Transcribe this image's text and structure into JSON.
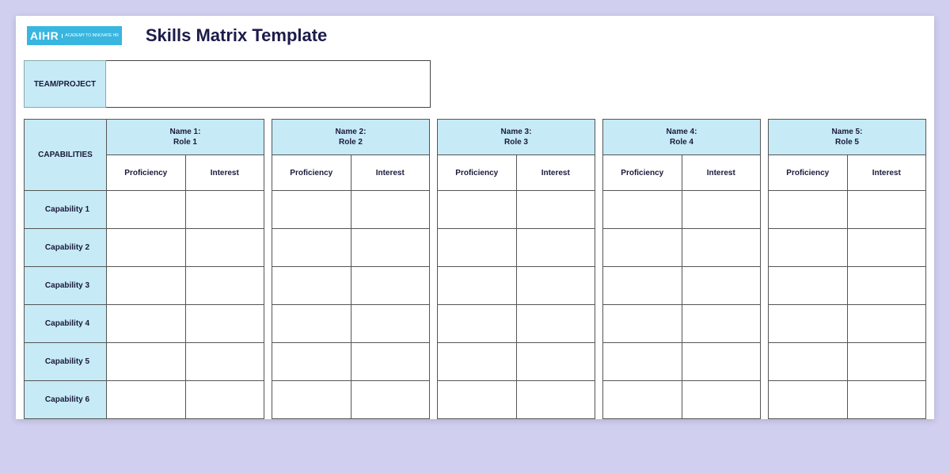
{
  "logo": {
    "main": "AIHR",
    "sub": "ACADEMY TO\nINNOVATE HR"
  },
  "title": "Skills Matrix Template",
  "team_project_label": "TEAM/PROJECT",
  "team_project_value": "",
  "capabilities_header": "CAPABILITIES",
  "people": [
    {
      "name": "Name 1:",
      "role": "Role 1"
    },
    {
      "name": "Name 2:",
      "role": "Role 2"
    },
    {
      "name": "Name 3:",
      "role": "Role 3"
    },
    {
      "name": "Name 4:",
      "role": "Role 4"
    },
    {
      "name": "Name 5:",
      "role": "Role 5"
    }
  ],
  "subheaders": {
    "proficiency": "Proficiency",
    "interest": "Interest"
  },
  "capabilities": [
    "Capability 1",
    "Capability 2",
    "Capability 3",
    "Capability 4",
    "Capability 5",
    "Capability 6"
  ]
}
